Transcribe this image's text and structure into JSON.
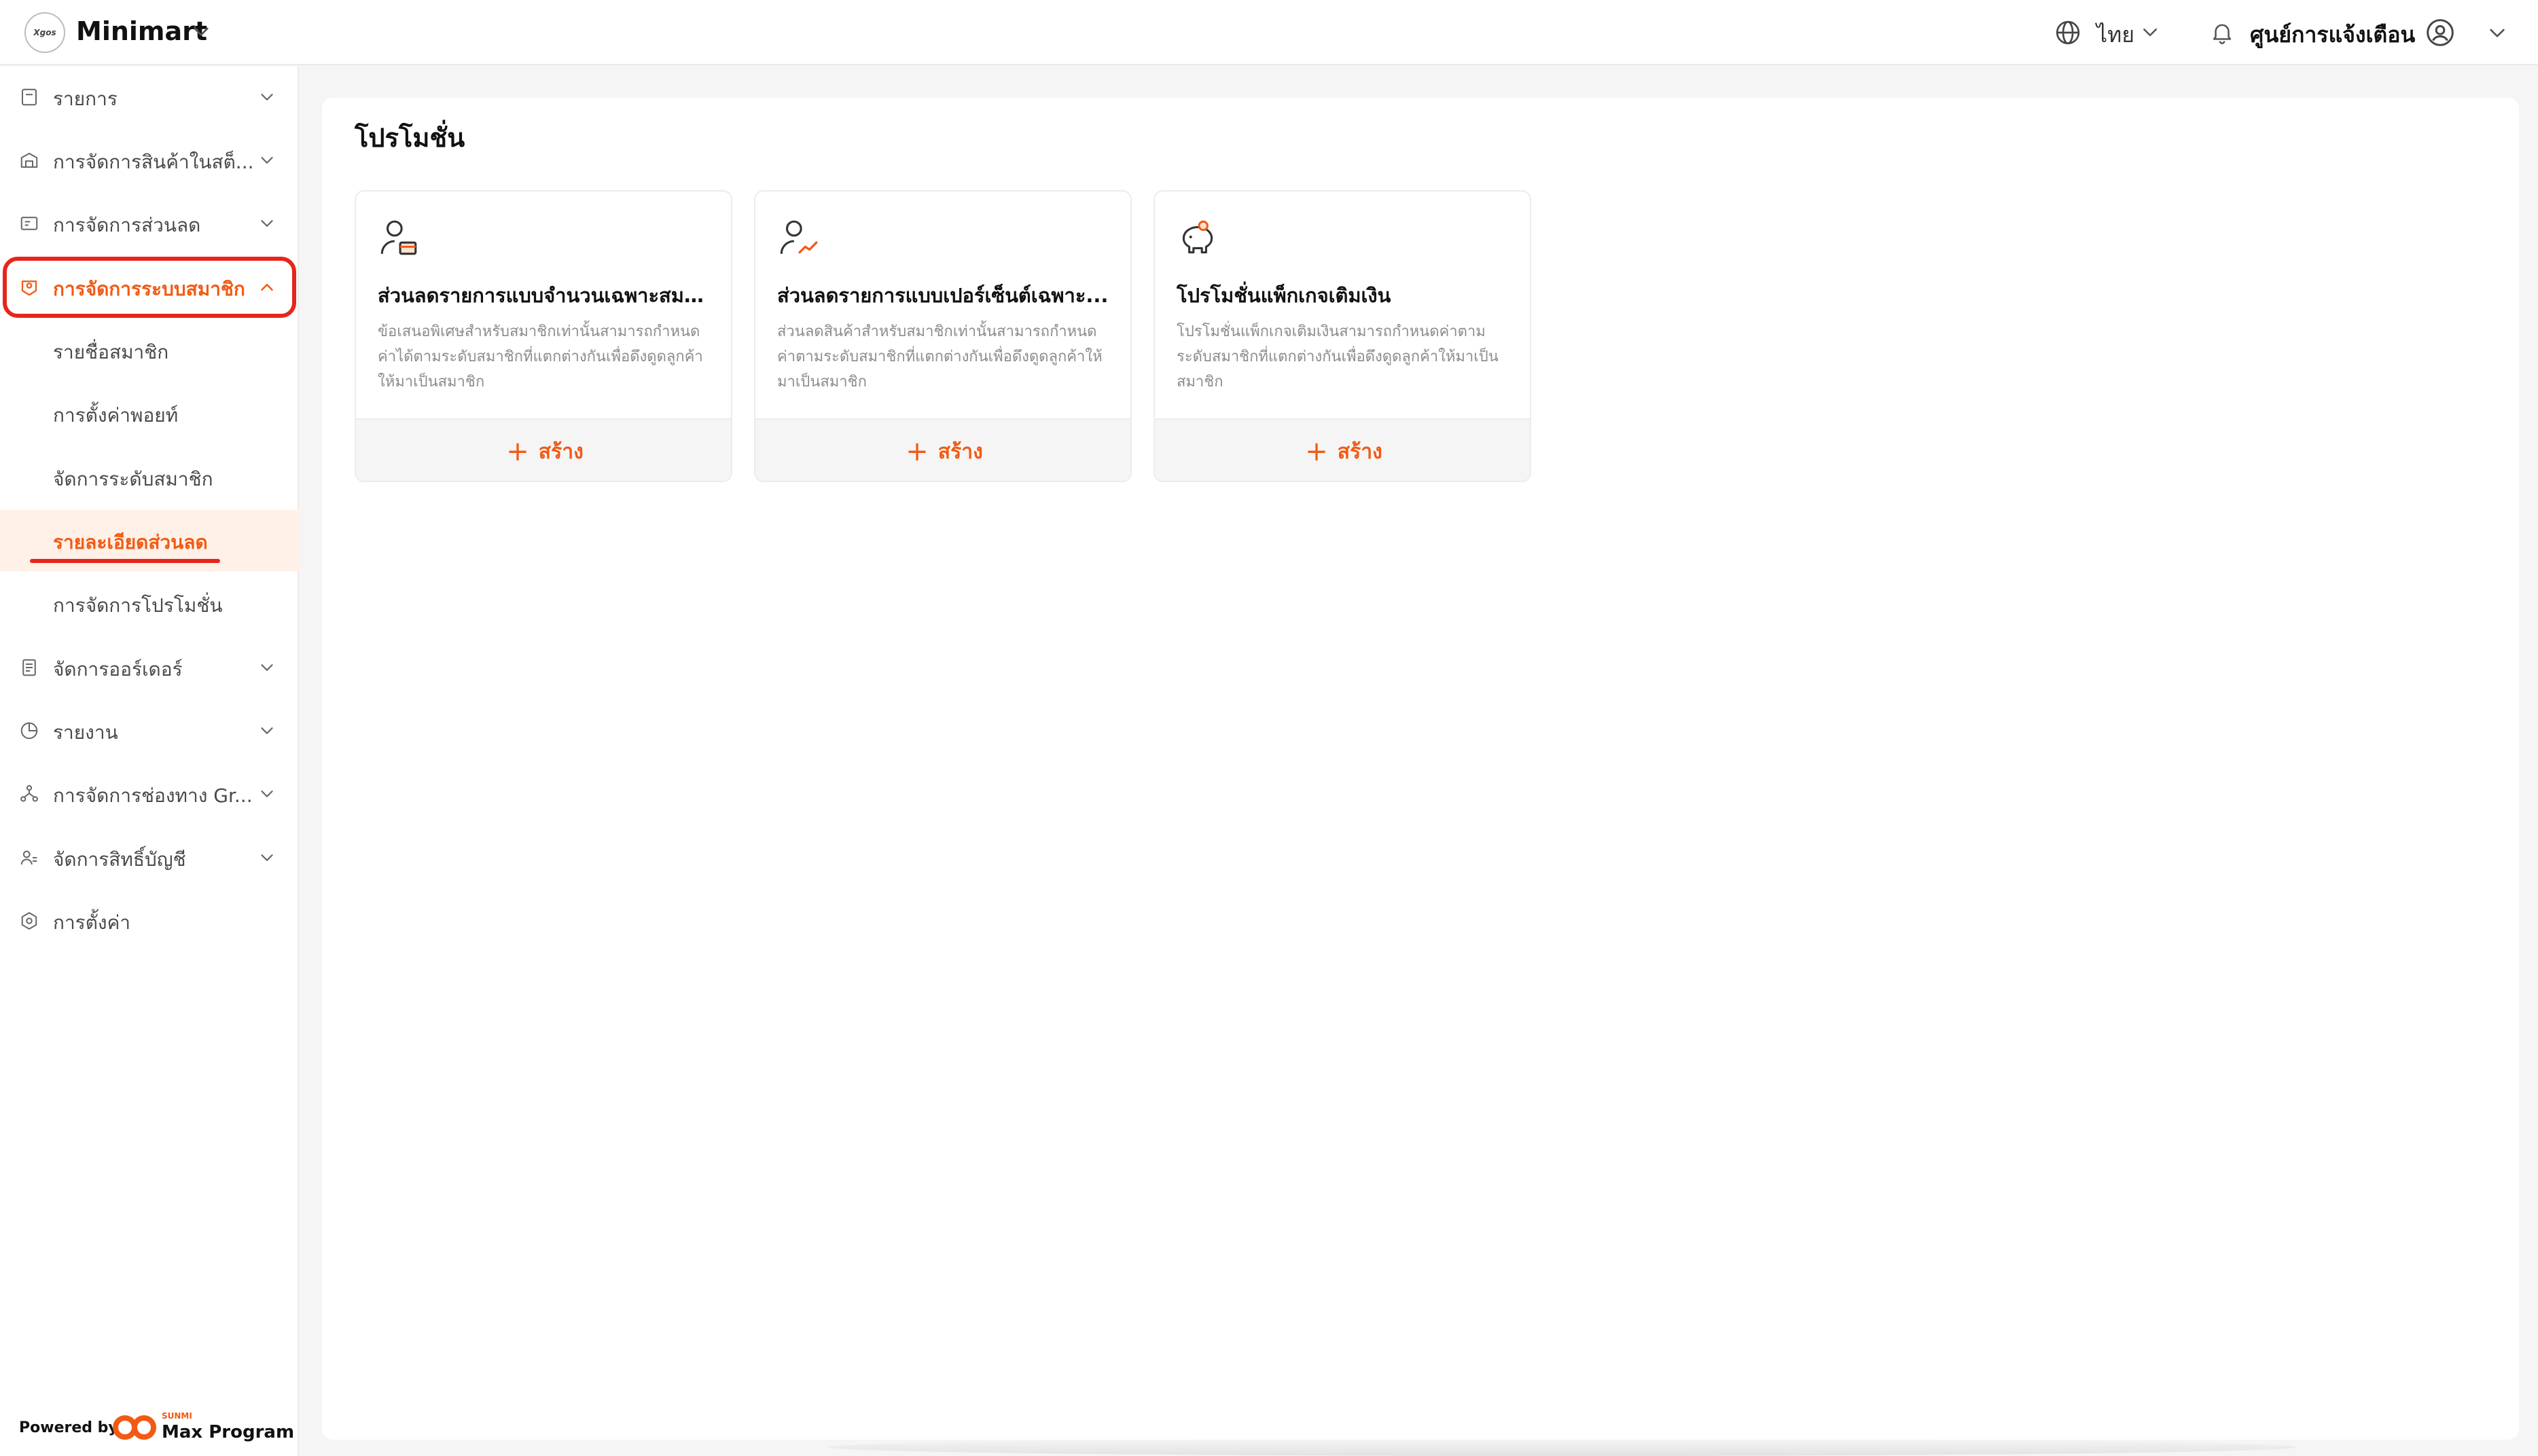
{
  "header": {
    "logo_text": "Xgos",
    "store_name": "Minimart",
    "language": "ไทย",
    "notification_center": "ศูนย์การแจ้งเตือน"
  },
  "sidebar": {
    "items": [
      {
        "label": "รายการ",
        "icon": "receipt-icon"
      },
      {
        "label": "การจัดการสินค้าในสต็...",
        "icon": "warehouse-icon"
      },
      {
        "label": "การจัดการส่วนลด",
        "icon": "coupon-icon"
      },
      {
        "label": "การจัดการระบบสมาชิก",
        "icon": "member-card-icon",
        "expanded": true
      },
      {
        "label": "จัดการออร์เดอร์",
        "icon": "order-list-icon"
      },
      {
        "label": "รายงาน",
        "icon": "pie-chart-icon"
      },
      {
        "label": "การจัดการช่องทาง Gr...",
        "icon": "channels-icon"
      },
      {
        "label": "จัดการสิทธิ์บัญชี",
        "icon": "account-permission-icon"
      },
      {
        "label": "การตั้งค่า",
        "icon": "settings-icon"
      }
    ],
    "sub_items": [
      {
        "label": "รายชื่อสมาชิก"
      },
      {
        "label": "การตั้งค่าพอยท์"
      },
      {
        "label": "จัดการระดับสมาชิก"
      },
      {
        "label": "รายละเอียดส่วนลด",
        "selected": true
      },
      {
        "label": "การจัดการโปรโมชั่น"
      }
    ],
    "footer": {
      "powered_by": "Powered by",
      "brand_small": "SUNMI",
      "brand_name": "Max Program"
    }
  },
  "main": {
    "title": "โปรโมชั่น",
    "cards": [
      {
        "icon": "member-discount-icon",
        "title": "ส่วนลดรายการแบบจำนวนเฉพาะสมาชิก...",
        "description": "ข้อเสนอพิเศษสำหรับสมาชิกเท่านั้นสามารถกำหนดค่าได้ตามระดับสมาชิกที่แตกต่างกันเพื่อดึงดูดลูกค้าให้มาเป็นสมาชิก",
        "action": "สร้าง"
      },
      {
        "icon": "member-percent-icon",
        "title": "ส่วนลดรายการแบบเปอร์เซ็นต์เฉพาะ...",
        "description": "ส่วนลดสินค้าสำหรับสมาชิกเท่านั้นสามารถกำหนดค่าตามระดับสมาชิกที่แตกต่างกันเพื่อดึงดูดลูกค้าให้มาเป็นสมาชิก",
        "action": "สร้าง"
      },
      {
        "icon": "piggy-bank-icon",
        "title": "โปรโมชั่นแพ็กเกจเติมเงิน",
        "description": "โปรโมชั่นแพ็กเกจเติมเงินสามารถกำหนดค่าตามระดับสมาชิกที่แตกต่างกันเพื่อดึงดูดลูกค้าให้มาเป็นสมาชิก",
        "action": "สร้าง"
      }
    ]
  },
  "colors": {
    "accent": "#f25a13",
    "highlight_red": "#e8251c",
    "selected_bg": "#fff1e8"
  }
}
